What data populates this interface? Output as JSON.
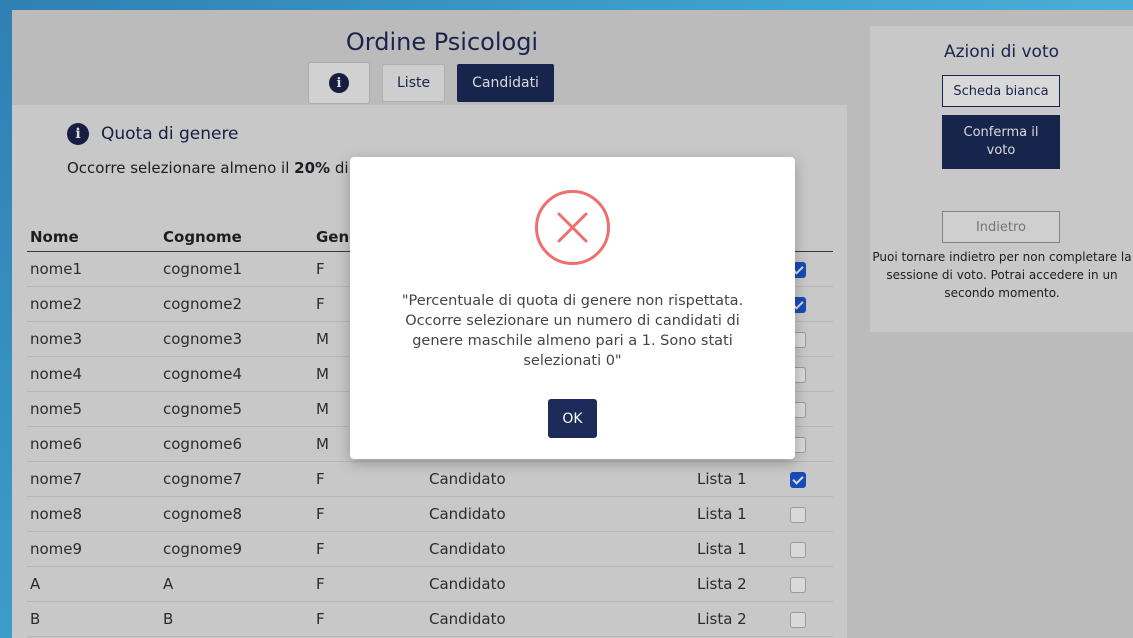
{
  "header": {
    "title": "Ordine Psicologi"
  },
  "tabs": {
    "info_icon": "info-icon",
    "liste": "Liste",
    "candidati": "Candidati"
  },
  "quota": {
    "title": "Quota di genere",
    "text_prefix": "Occorre selezionare almeno il ",
    "percent": "20%",
    "text_suffix": " di c"
  },
  "table": {
    "headers": [
      "Nome",
      "Cognome",
      "Gene"
    ],
    "rows": [
      {
        "nome": "nome1",
        "cognome": "cognome1",
        "genere": "F",
        "ruolo": "",
        "lista": "",
        "checked": true
      },
      {
        "nome": "nome2",
        "cognome": "cognome2",
        "genere": "F",
        "ruolo": "",
        "lista": "",
        "checked": true
      },
      {
        "nome": "nome3",
        "cognome": "cognome3",
        "genere": "M",
        "ruolo": "",
        "lista": "",
        "checked": false
      },
      {
        "nome": "nome4",
        "cognome": "cognome4",
        "genere": "M",
        "ruolo": "",
        "lista": "",
        "checked": false
      },
      {
        "nome": "nome5",
        "cognome": "cognome5",
        "genere": "M",
        "ruolo": "",
        "lista": "",
        "checked": false
      },
      {
        "nome": "nome6",
        "cognome": "cognome6",
        "genere": "M",
        "ruolo": "",
        "lista": "",
        "checked": false
      },
      {
        "nome": "nome7",
        "cognome": "cognome7",
        "genere": "F",
        "ruolo": "Candidato",
        "lista": "Lista 1",
        "checked": true
      },
      {
        "nome": "nome8",
        "cognome": "cognome8",
        "genere": "F",
        "ruolo": "Candidato",
        "lista": "Lista 1",
        "checked": false
      },
      {
        "nome": "nome9",
        "cognome": "cognome9",
        "genere": "F",
        "ruolo": "Candidato",
        "lista": "Lista 1",
        "checked": false
      },
      {
        "nome": "A",
        "cognome": "A",
        "genere": "F",
        "ruolo": "Candidato",
        "lista": "Lista 2",
        "checked": false
      },
      {
        "nome": "B",
        "cognome": "B",
        "genere": "F",
        "ruolo": "Candidato",
        "lista": "Lista 2",
        "checked": false
      }
    ]
  },
  "actions": {
    "title": "Azioni di voto",
    "scheda_bianca": "Scheda bianca",
    "conferma": "Conferma il voto",
    "indietro": "Indietro",
    "indietro_note": "Puoi tornare indietro per non completare la sessione di voto. Potrai accedere in un secondo momento."
  },
  "modal": {
    "icon": "error-x-icon",
    "message": "\"Percentuale di quota di genere non rispettata. Occorre selezionare un numero di candidati di genere maschile almeno pari a 1. Sono stati selezionati 0\"",
    "ok": "OK"
  },
  "colors": {
    "accent": "#1c2b5a",
    "error": "#ef6f6f",
    "checkbox": "#1f58d6"
  }
}
